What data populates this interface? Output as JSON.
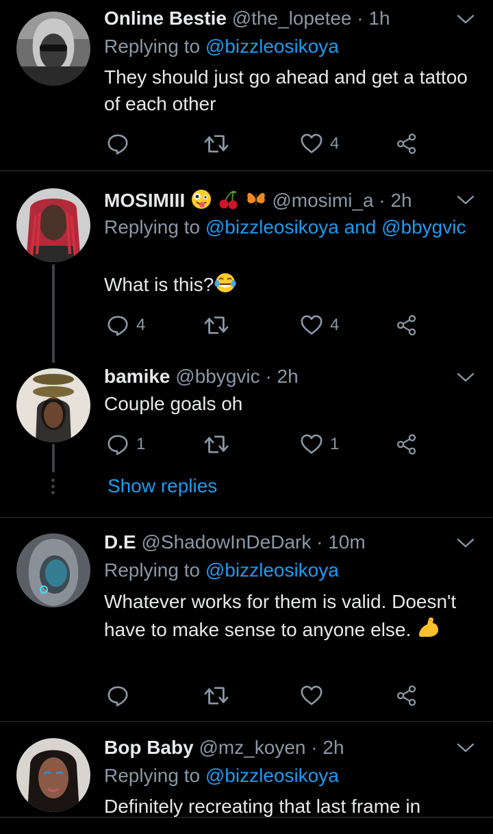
{
  "colors": {
    "background": "#000000",
    "divider": "#2f3336",
    "text_primary": "#e7e9ea",
    "text_secondary": "#8b98a5",
    "accent": "#1d9bf0"
  },
  "tweets": [
    {
      "name": "Online Bestie",
      "handle": "@the_lopetee",
      "sep": "·",
      "time": "1h",
      "replying_prefix": "Replying to",
      "replying_to": "@bizzleosikoya",
      "replying_and": "",
      "replying_to_2": "",
      "text": "They should just go ahead and get a tattoo of each other",
      "reply_count": "",
      "retweet_count": "",
      "like_count": "4"
    },
    {
      "name": "MOSIMIII",
      "name_emojis": [
        "zany-face-emoji",
        "cherries-emoji",
        "butterfly-emoji"
      ],
      "handle": "@mosimi_a",
      "sep": "·",
      "time": "2h",
      "replying_prefix": "Replying to",
      "replying_to": "@bizzleosikoya",
      "replying_and": "and",
      "replying_to_2": "@bbygvic",
      "text": "What is this?",
      "text_emoji": "tears-of-joy-emoji",
      "reply_count": "4",
      "retweet_count": "",
      "like_count": "4"
    },
    {
      "name": "bamike",
      "handle": "@bbygvic",
      "sep": "·",
      "time": "2h",
      "text": "Couple goals oh",
      "reply_count": "1",
      "retweet_count": "",
      "like_count": "1",
      "show_replies": "Show replies"
    },
    {
      "name": "D.E",
      "handle": "@ShadowInDeDark",
      "sep": "·",
      "time": "10m",
      "replying_prefix": "Replying to",
      "replying_to": "@bizzleosikoya",
      "text": "Whatever works for them is valid. Doesn't have to make sense to anyone else.",
      "text_emoji": "flexed-biceps-emoji",
      "reply_count": "",
      "retweet_count": "",
      "like_count": ""
    },
    {
      "name": "Bop Baby",
      "handle": "@mz_koyen",
      "sep": "·",
      "time": "2h",
      "replying_prefix": "Replying to",
      "replying_to": "@bizzleosikoya",
      "text": "Definitely recreating that last frame in"
    }
  ]
}
